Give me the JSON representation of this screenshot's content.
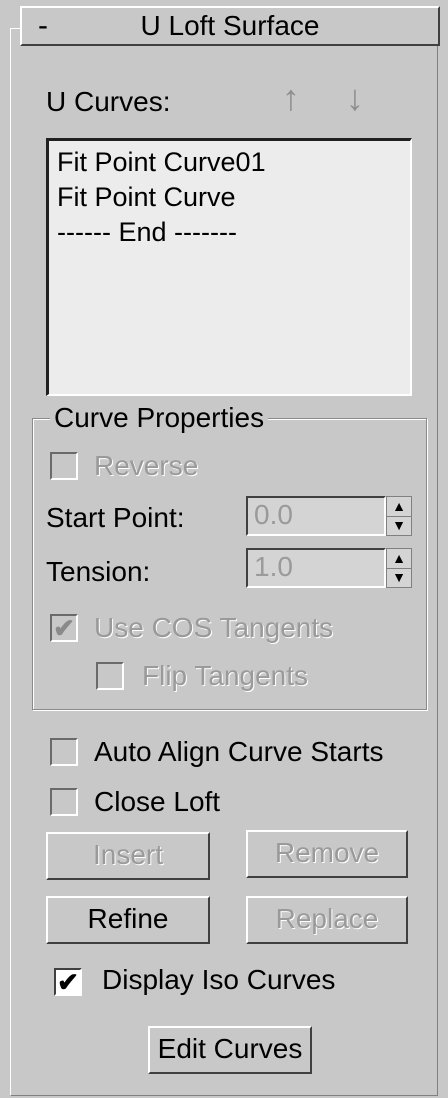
{
  "rollout": {
    "collapse_symbol": "-",
    "title": "U Loft Surface"
  },
  "u_curves": {
    "label": "U Curves:",
    "up_icon": "arrow-up-icon",
    "down_icon": "arrow-down-icon",
    "items": [
      "Fit Point Curve01",
      "Fit Point Curve",
      "------ End -------"
    ]
  },
  "curve_properties": {
    "title": "Curve Properties",
    "reverse": {
      "label": "Reverse",
      "checked": false,
      "enabled": false
    },
    "start_point": {
      "label": "Start Point:",
      "value": "0.0"
    },
    "tension": {
      "label": "Tension:",
      "value": "1.0"
    },
    "use_cos_tangents": {
      "label": "Use COS Tangents",
      "checked": true,
      "enabled": false
    },
    "flip_tangents": {
      "label": "Flip Tangents",
      "checked": false,
      "enabled": false
    }
  },
  "options": {
    "auto_align": {
      "label": "Auto Align Curve Starts",
      "checked": false
    },
    "close_loft": {
      "label": "Close Loft",
      "checked": false
    }
  },
  "buttons": {
    "insert": "Insert",
    "remove": "Remove",
    "refine": "Refine",
    "replace": "Replace",
    "edit_curves": "Edit Curves"
  },
  "display_iso": {
    "label": "Display Iso Curves",
    "checked": true
  },
  "check_mark": "✔"
}
